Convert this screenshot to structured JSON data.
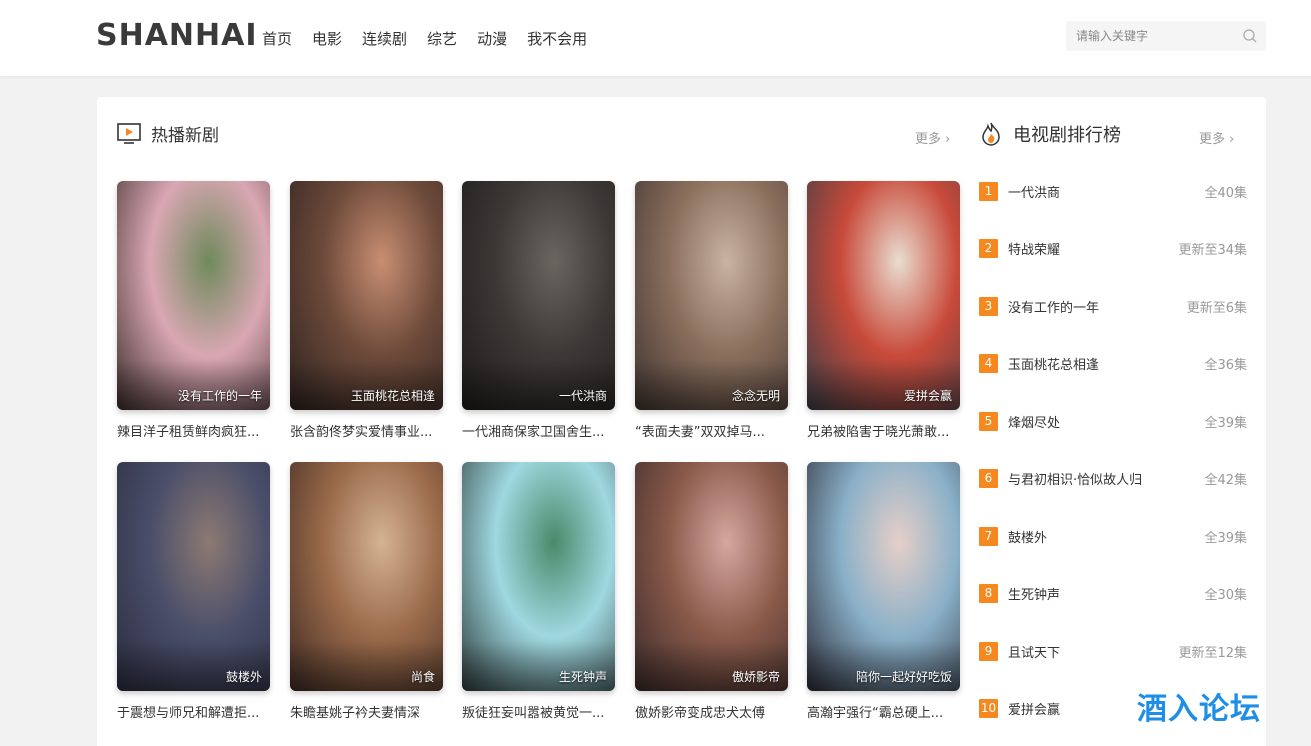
{
  "header": {
    "logo": "SHANHAI",
    "nav": [
      "首页",
      "电影",
      "连续剧",
      "综艺",
      "动漫",
      "我不会用"
    ],
    "search_placeholder": "请输入关键字"
  },
  "hot": {
    "title": "热播新剧",
    "more": "更多",
    "items": [
      {
        "tag": "没有工作的一年",
        "desc": "辣目洋子租赁鲜肉疯狂...",
        "colors": [
          "#d9a7b3",
          "#6f8a5c",
          "#3a2b2a"
        ]
      },
      {
        "tag": "玉面桃花总相逢",
        "desc": "张含韵佟梦实爱情事业...",
        "colors": [
          "#6d4a3a",
          "#c98e73",
          "#2d2220"
        ]
      },
      {
        "tag": "一代洪商",
        "desc": "一代湘商保家卫国舍生...",
        "colors": [
          "#3b3836",
          "#6b6560",
          "#1d1b1a"
        ]
      },
      {
        "tag": "念念无明",
        "desc": "“表面夫妻”双双掉马...",
        "colors": [
          "#8a6e5c",
          "#c9b3a1",
          "#3d3330"
        ]
      },
      {
        "tag": "爱拼会赢",
        "desc": "兄弟被陷害于晓光萧敢...",
        "colors": [
          "#c84a3a",
          "#e9ddd0",
          "#3a3d46"
        ]
      },
      {
        "tag": "鼓楼外",
        "desc": "于震想与师兄和解遭拒...",
        "colors": [
          "#4a4e6a",
          "#8c7a72",
          "#2a2c3d"
        ]
      },
      {
        "tag": "尚食",
        "desc": "朱瞻基姚子衿夫妻情深",
        "colors": [
          "#9a6a4a",
          "#d4b394",
          "#3e2a22"
        ]
      },
      {
        "tag": "生死钟声",
        "desc": "叛徒狂妄叫嚣被黄觉一...",
        "colors": [
          "#9fd8e0",
          "#4a8a6a",
          "#2d3a3a"
        ]
      },
      {
        "tag": "傲娇影帝",
        "desc": "傲娇影帝变成忠犬太傅",
        "colors": [
          "#8a5a4a",
          "#d6a7a0",
          "#3a2a2a"
        ]
      },
      {
        "tag": "陪你一起好好吃饭",
        "desc": "高瀚宇强行“霸总硬上...",
        "colors": [
          "#8ab0c8",
          "#e6cfc8",
          "#2a2a35"
        ]
      }
    ]
  },
  "ranking": {
    "title": "电视剧排行榜",
    "more": "更多",
    "items": [
      {
        "num": "1",
        "name": "一代洪商",
        "ep": "全40集"
      },
      {
        "num": "2",
        "name": "特战荣耀",
        "ep": "更新至34集"
      },
      {
        "num": "3",
        "name": "没有工作的一年",
        "ep": "更新至6集"
      },
      {
        "num": "4",
        "name": "玉面桃花总相逢",
        "ep": "全36集"
      },
      {
        "num": "5",
        "name": "烽烟尽处",
        "ep": "全39集"
      },
      {
        "num": "6",
        "name": "与君初相识·恰似故人归",
        "ep": "全42集"
      },
      {
        "num": "7",
        "name": "鼓楼外",
        "ep": "全39集"
      },
      {
        "num": "8",
        "name": "生死钟声",
        "ep": "全30集"
      },
      {
        "num": "9",
        "name": "且试天下",
        "ep": "更新至12集"
      },
      {
        "num": "10",
        "name": "爱拼会赢",
        "ep": ""
      }
    ]
  },
  "watermark": "酒入论坛"
}
